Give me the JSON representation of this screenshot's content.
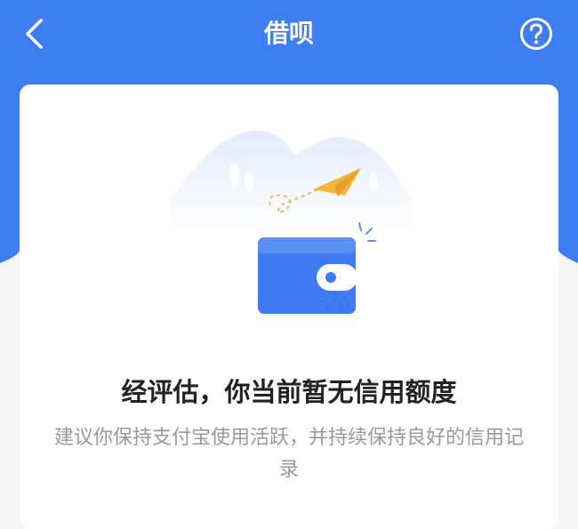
{
  "header": {
    "title": "借呗",
    "back_icon": "chevron-left-icon",
    "help_icon": "question-circle-icon",
    "background_color": "#3d7ff2"
  },
  "card": {
    "illustration": "wallet-with-paper-plane-illustration",
    "headline": "经评估，你当前暂无信用额度",
    "subtext": "建议你保持支付宝使用活跃，并持续保持良好的信用记录"
  },
  "colors": {
    "accent": "#3d7ff2",
    "wallet": "#3f7bf2",
    "paper_plane": "#f5b53c",
    "headline_text": "#222222",
    "subtext": "#999999"
  }
}
